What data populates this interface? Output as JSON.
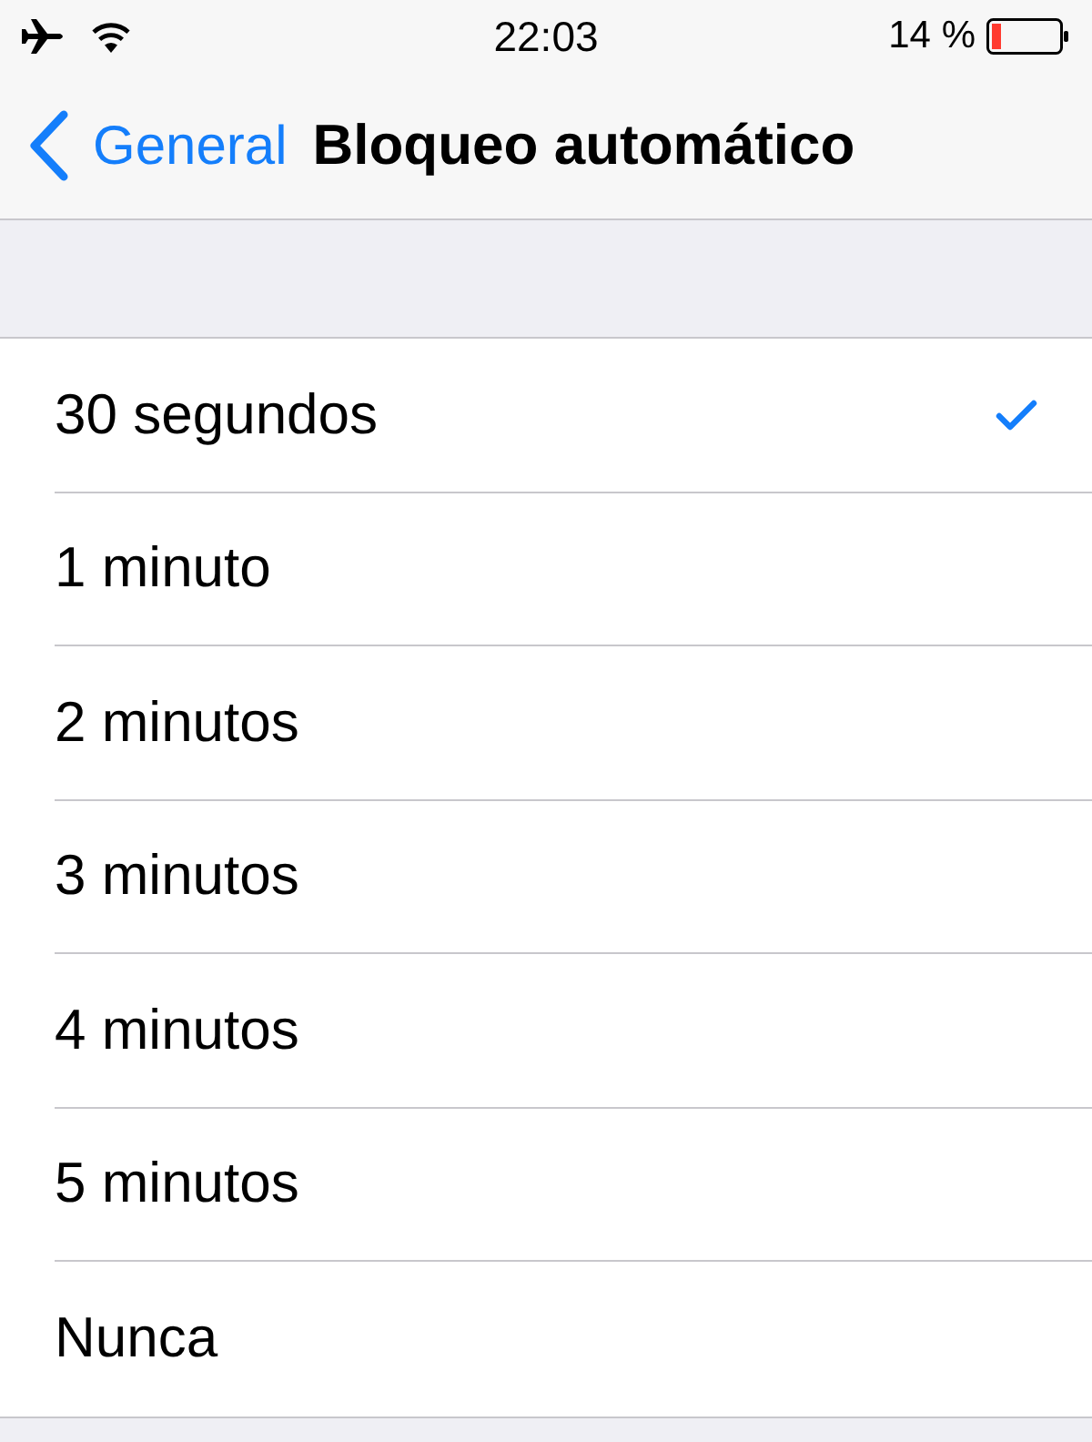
{
  "status_bar": {
    "time": "22:03",
    "battery_text": "14 %"
  },
  "nav_bar": {
    "back_label": "General",
    "title": "Bloqueo automático"
  },
  "options": [
    {
      "label": "30 segundos",
      "selected": true
    },
    {
      "label": "1 minuto",
      "selected": false
    },
    {
      "label": "2 minutos",
      "selected": false
    },
    {
      "label": "3 minutos",
      "selected": false
    },
    {
      "label": "4 minutos",
      "selected": false
    },
    {
      "label": "5 minutos",
      "selected": false
    },
    {
      "label": "Nunca",
      "selected": false
    }
  ]
}
